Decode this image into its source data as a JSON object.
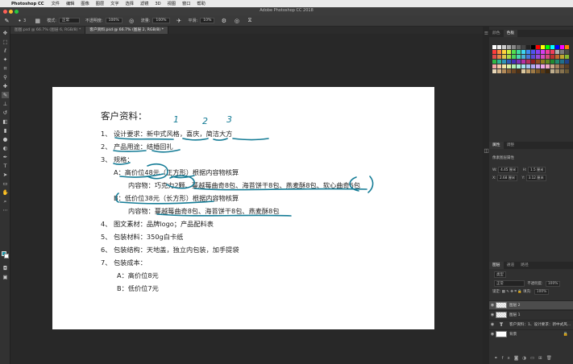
{
  "menubar": {
    "app": "Photoshop CC",
    "items": [
      "文件",
      "编辑",
      "图像",
      "图层",
      "文字",
      "选择",
      "滤镜",
      "3D",
      "视图",
      "窗口",
      "帮助"
    ]
  },
  "window": {
    "title": "Adobe Photoshop CC 2018"
  },
  "options": {
    "brush_size": "3",
    "mode_label": "模式:",
    "mode_value": "正常",
    "opacity_label": "不透明度:",
    "opacity_value": "100%",
    "flow_label": "流量:",
    "flow_value": "100%",
    "smooth_label": "平滑:",
    "smooth_value": "10%"
  },
  "tabs": [
    {
      "label": "图图.psd @ 66.7% (图层 6, RGB/8) *"
    },
    {
      "label": "客户资料.psd @ 66.7% (图层 2, RGB/8) *"
    }
  ],
  "document": {
    "title": "客户资料：",
    "lines": [
      "1、 设计要求：新中式风格，喜庆，简洁大方",
      "2、 产品用途：结婚回礼",
      "3、 规格：",
      "A：高价位48元（正方形）根据内容物核算",
      "内容物：巧克力2颗、蔓越莓曲奇8包、海苔饼干8包、燕麦酥8包、软心曲奇6包",
      "B：低价位38元（长方形）根据内容物核算",
      "内容物：蔓越莓曲奇8包、海苔饼干8包、燕麦酥8包",
      "4、 图文素材：品牌logo；产品配料表",
      "5、 包装材料：350g白卡纸",
      "6、 包装结构：天地盖，独立内包装，加手提袋",
      "7、 包装成本：",
      "A：高价位8元",
      "B：低价位7元"
    ],
    "annotations": [
      "1",
      "2",
      "3"
    ],
    "ink_color": "#157c96"
  },
  "panels": {
    "top_tabs": [
      "颜色",
      "色板"
    ],
    "props_tabs": [
      "属性",
      "调整"
    ],
    "props_title": "像素图层属性",
    "props": {
      "w_label": "W:",
      "w": "4.45 厘米",
      "h_label": "H:",
      "h": "1.5 厘米",
      "x_label": "X:",
      "x": "2.68 厘米",
      "y_label": "Y:",
      "y": "3.12 厘米"
    },
    "layer_tabs": [
      "图层",
      "通道",
      "路径"
    ],
    "kind_label": "类型",
    "blend_mode": "正常",
    "opacity_label": "不透明度:",
    "opacity": "100%",
    "lock_label": "锁定:",
    "fill_label": "填充:",
    "fill": "100%",
    "layers": [
      {
        "name": "图层 2",
        "kind": "pixel",
        "selected": true
      },
      {
        "name": "图层 1",
        "kind": "pixel",
        "selected": false
      },
      {
        "name": "客户资料：1、设计要求：新中式风...",
        "kind": "text",
        "selected": false
      },
      {
        "name": "背景",
        "kind": "background",
        "selected": false
      }
    ]
  },
  "colors": {
    "foreground": "#1e96a6",
    "background": "#ffffff",
    "swatches": [
      "#ffffff",
      "#eeeeee",
      "#cccccc",
      "#aaaaaa",
      "#888888",
      "#666666",
      "#444444",
      "#222222",
      "#000000",
      "#ff0000",
      "#ffff00",
      "#00ff00",
      "#00ffff",
      "#0000ff",
      "#ff00ff",
      "#ff8000",
      "#ff3b3b",
      "#ff8a3d",
      "#ffd23d",
      "#c8f03d",
      "#53e04f",
      "#3de0a0",
      "#3dd6f0",
      "#3d8af0",
      "#4f53f0",
      "#8a3df0",
      "#d63df0",
      "#f03d9b",
      "#f03d5a",
      "#b0b0b0",
      "#7a7a7a",
      "#4a4a4a",
      "#e24a4a",
      "#e2834a",
      "#e2c74a",
      "#a7d94a",
      "#4ad95c",
      "#4ad9b3",
      "#4ab3d9",
      "#4a77d9",
      "#5c4ad9",
      "#9a4ad9",
      "#d94ac2",
      "#d94a7a",
      "#c03030",
      "#c06a30",
      "#c0a630",
      "#86b830",
      "#30b844",
      "#30b896",
      "#3096b8",
      "#305ab8",
      "#4430b8",
      "#7e30b8",
      "#b830a4",
      "#b8305e",
      "#902020",
      "#904e20",
      "#907c20",
      "#628a20",
      "#208a30",
      "#208a70",
      "#20708a",
      "#20428a",
      "#f4a7a7",
      "#f4c7a7",
      "#f4e7a7",
      "#dcf0a7",
      "#b1efb0",
      "#a7f0d6",
      "#a7e3f0",
      "#a7c3f0",
      "#b1a7f0",
      "#d1a7f0",
      "#f0a7e6",
      "#f0a7c3",
      "#c9a887",
      "#a3805c",
      "#7b5a3a",
      "#5a3f25",
      "#e8d7b8",
      "#d3b48a",
      "#b38b5a",
      "#8a6236",
      "#6b4622",
      "#4d3015",
      "#dcc8a0",
      "#c2a26e",
      "#9e7a46",
      "#7a5728",
      "#5a3b16",
      "#3d270c",
      "#bfae8e",
      "#a28e6c",
      "#86724e",
      "#6a5834"
    ]
  }
}
